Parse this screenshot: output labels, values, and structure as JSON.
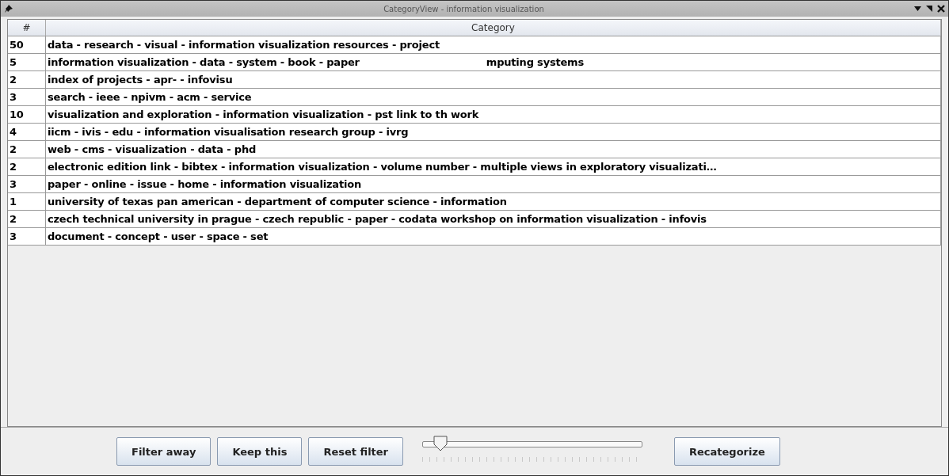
{
  "window": {
    "title": "CategoryView - information visualization"
  },
  "table": {
    "columns": [
      "#",
      "Category"
    ],
    "rows": [
      {
        "count": "50",
        "category": "data - research - visual - information visualization resources - project"
      },
      {
        "count": "5",
        "category": "information visualization - data - system - book - paper",
        "fragment": "mputing systems"
      },
      {
        "count": "2",
        "category": "index of projects - apr- - infovisu"
      },
      {
        "count": "3",
        "category": "search - ieee - npivm - acm - service"
      },
      {
        "count": "10",
        "category": "visualization and exploration - information visualization - pst link to th work"
      },
      {
        "count": "4",
        "category": "iicm - ivis - edu - information visualisation research group - ivrg"
      },
      {
        "count": "2",
        "category": "web - cms - visualization - data - phd"
      },
      {
        "count": "2",
        "category": "electronic edition link - bibtex - information visualization - volume number - multiple views in exploratory visualizati…"
      },
      {
        "count": "3",
        "category": "paper - online - issue - home - information visualization"
      },
      {
        "count": "1",
        "category": "university of texas pan american - department of computer science - information"
      },
      {
        "count": "2",
        "category": "czech technical university in prague - czech republic - paper - codata workshop on information visualization - infovis"
      },
      {
        "count": "3",
        "category": "document - concept - user - space - set"
      }
    ]
  },
  "buttons": [
    "Filter away",
    "Keep this",
    "Reset filter"
  ],
  "slider": {
    "level": 0.08
  },
  "recategorize_button": "Recategorize"
}
